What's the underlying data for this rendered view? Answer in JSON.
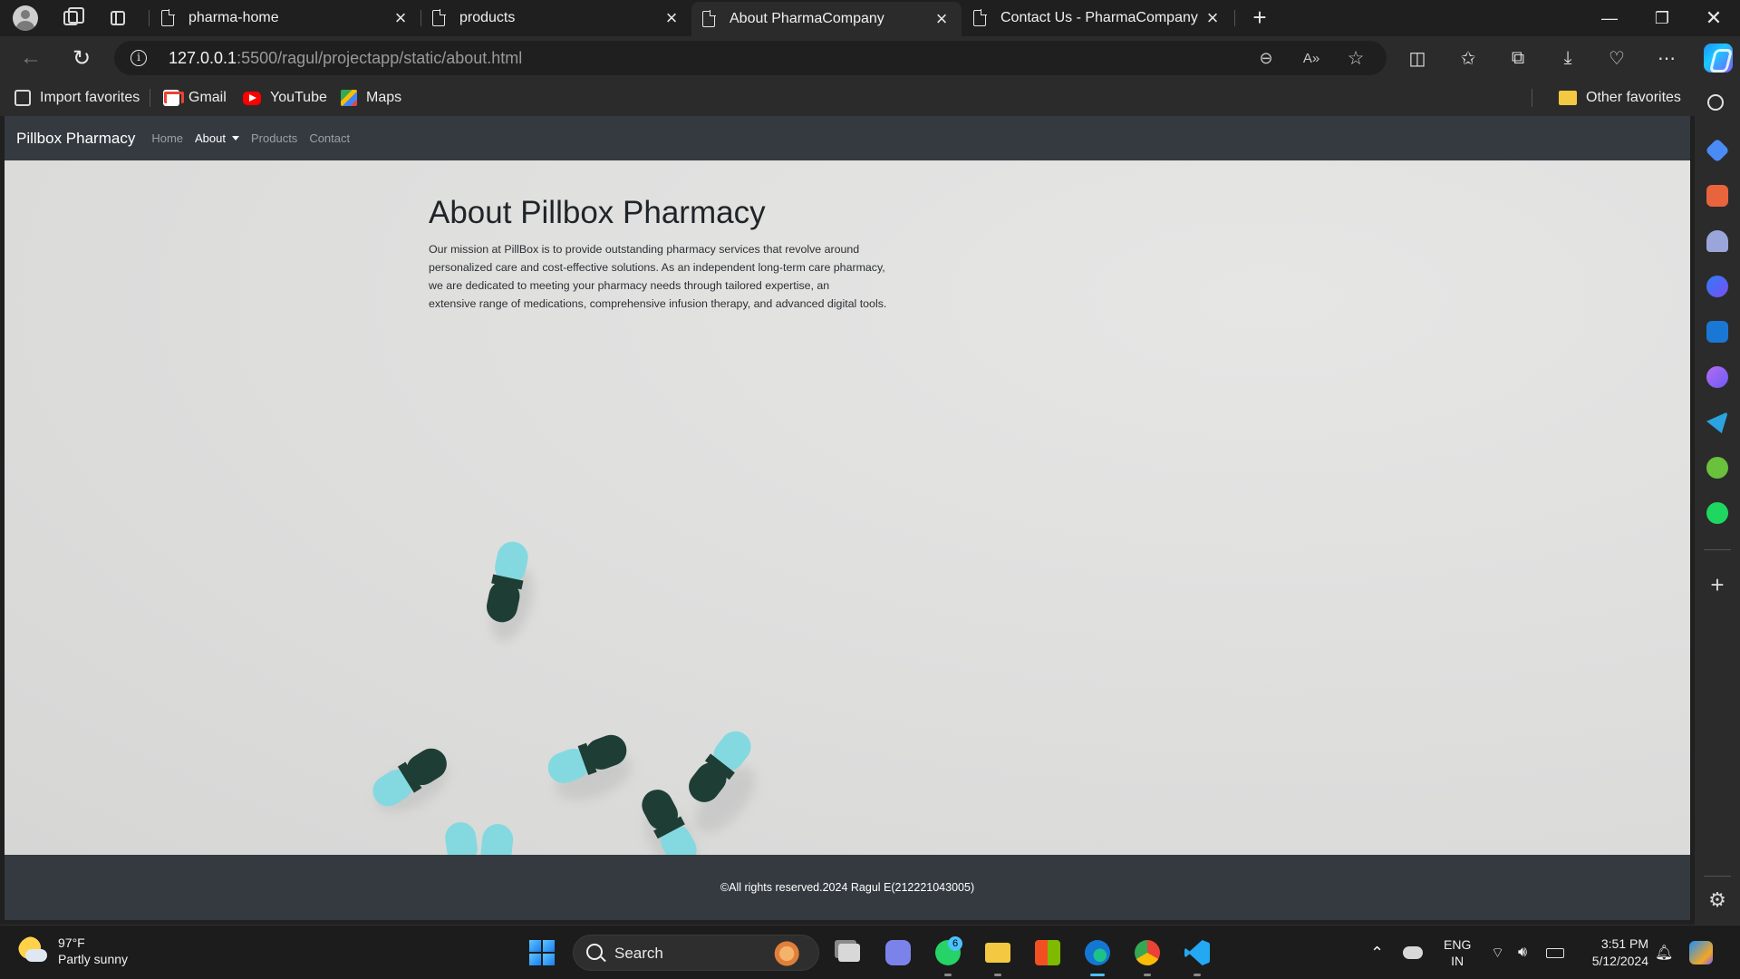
{
  "browser": {
    "tabs": [
      {
        "title": "pharma-home"
      },
      {
        "title": "products"
      },
      {
        "title": "About PharmaCompany"
      },
      {
        "title": "Contact Us - PharmaCompany"
      }
    ],
    "url": {
      "host": "127.0.0.1",
      "rest": ":5500/ragul/projectapp/static/about.html"
    },
    "favorites": [
      {
        "label": "Import favorites",
        "icon": "import-icon"
      },
      {
        "label": "Gmail",
        "icon": "gmail-icon"
      },
      {
        "label": "YouTube",
        "icon": "youtube-icon"
      },
      {
        "label": "Maps",
        "icon": "maps-icon"
      }
    ],
    "other_favorites": "Other favorites"
  },
  "site": {
    "brand": "Pillbox Pharmacy",
    "nav": [
      "Home",
      "About",
      "Products",
      "Contact"
    ],
    "about": {
      "title": "About Pillbox Pharmacy",
      "lines": [
        "Our mission at PillBox is to provide outstanding pharmacy services that revolve around",
        "personalized care and cost-effective solutions. As an independent long-term care pharmacy,",
        "we are dedicated to meeting your pharmacy needs through tailored expertise, an",
        "extensive range of medications, comprehensive infusion therapy, and advanced digital tools."
      ]
    },
    "footer": "©All rights reserved.2024 Ragul E(212221043005)",
    "colors": {
      "navbar": "#343a40",
      "hero_bg": "#e2e2e1",
      "capsule_teal": "#7fd6de",
      "capsule_dark": "#1d3b34"
    }
  },
  "taskbar": {
    "weather": {
      "temp": "97°F",
      "desc": "Partly sunny"
    },
    "search": "Search",
    "whatsapp_badge": "6",
    "lang": {
      "line1": "ENG",
      "line2": "IN"
    },
    "clock": {
      "time": "3:51 PM",
      "date": "5/12/2024"
    }
  }
}
